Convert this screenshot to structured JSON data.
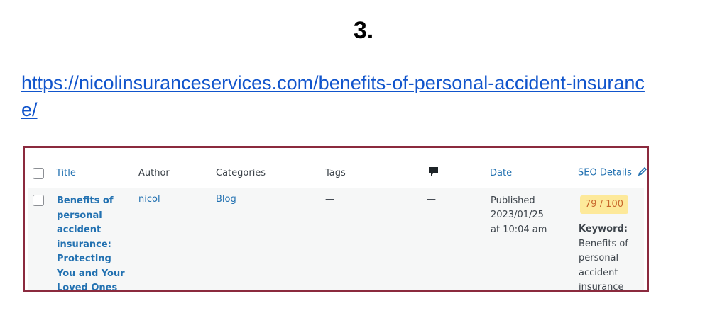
{
  "heading": "3.",
  "url": "https://nicolinsuranceservices.com/benefits-of-personal-accident-insurance/",
  "table": {
    "columns": {
      "title": "Title",
      "author": "Author",
      "categories": "Categories",
      "tags": "Tags",
      "comments_icon": "comment-icon",
      "date": "Date",
      "seo": "SEO Details",
      "seo_icon": "pencil-icon"
    },
    "row": {
      "title": "Benefits of personal accident insurance: Protecting You and Your Loved Ones",
      "author": "nicol",
      "category": "Blog",
      "tags": "—",
      "comments": "—",
      "date_status": "Published",
      "date_value": "2023/01/25 at 10:04 am",
      "seo_score": "79 / 100",
      "keyword_label": "Keyword:",
      "keyword_value": "Benefits of personal accident insurance"
    }
  },
  "colors": {
    "link": "#2271b1",
    "frame": "#8b2a3e",
    "score_bg": "#fde99a",
    "score_text": "#c8672c"
  }
}
